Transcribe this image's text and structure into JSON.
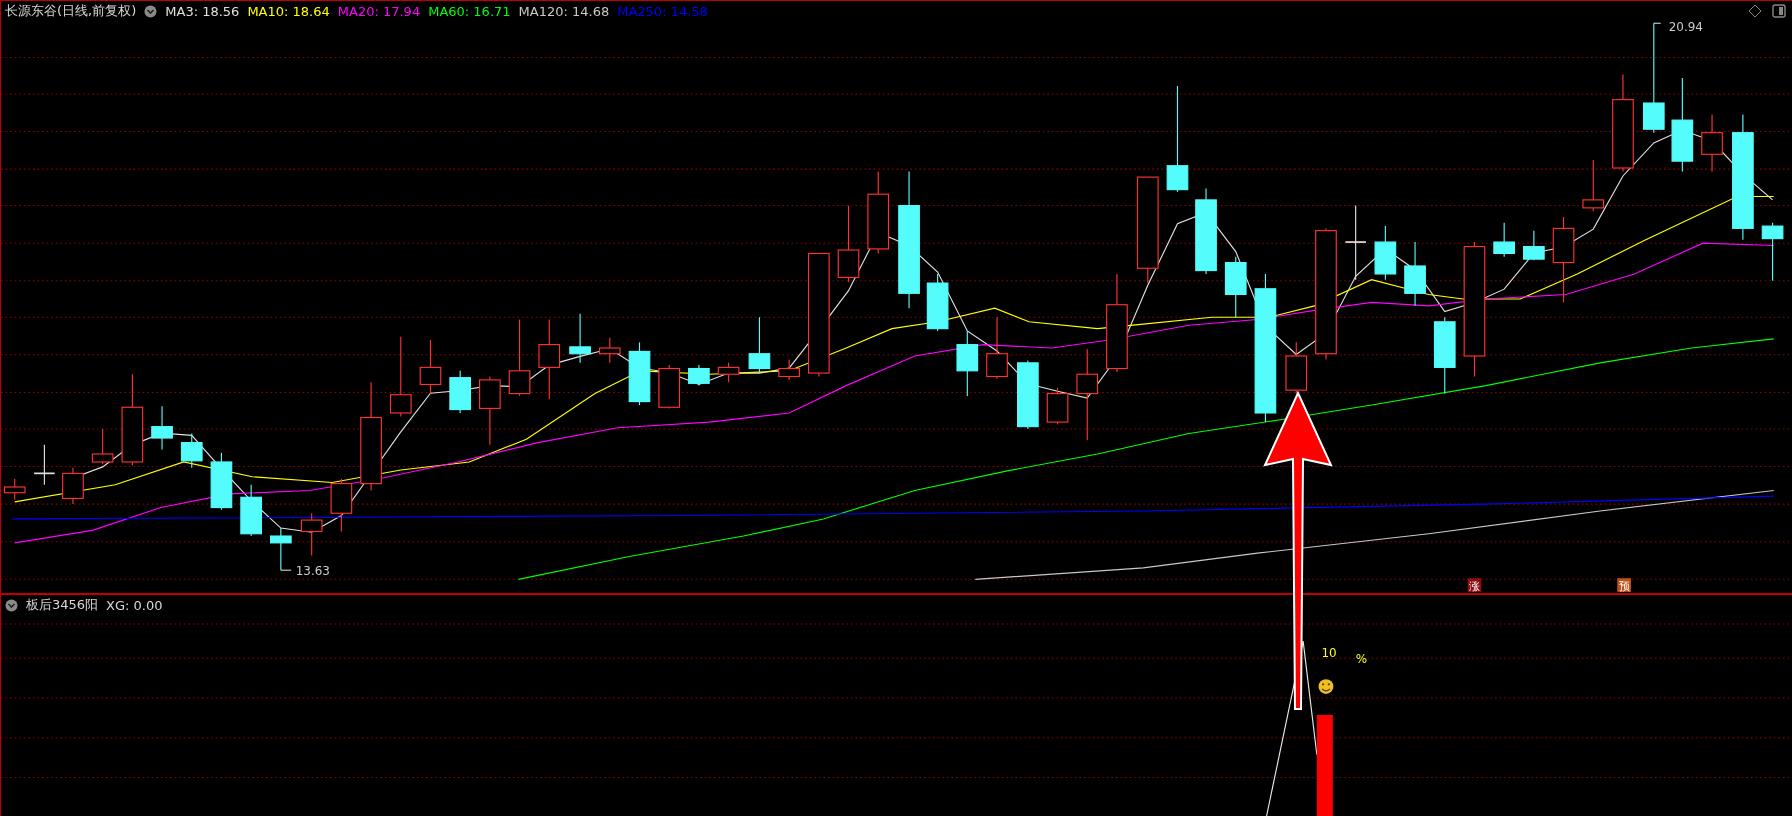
{
  "main_panel": {
    "title": "长源东谷(日线,前复权)",
    "indicators": [
      {
        "label": "MA3: 18.56",
        "color": "#e0e0e0"
      },
      {
        "label": "MA10: 18.64",
        "color": "#ffff00"
      },
      {
        "label": "MA20: 17.94",
        "color": "#ff00ff"
      },
      {
        "label": "MA60: 16.71",
        "color": "#00ff00"
      },
      {
        "label": "MA120: 14.68",
        "color": "#c8c8c8"
      },
      {
        "label": "MA250: 14.58",
        "color": "#0000ff"
      }
    ],
    "high_label": "20.94",
    "low_label": "13.63",
    "markers": [
      {
        "text": "涨",
        "color": "#8b0d0d"
      },
      {
        "text": "预",
        "color": "#c0501a"
      }
    ]
  },
  "sub_panel": {
    "title": "板后3456阳",
    "value": "XG: 0.00",
    "signal_number": "10",
    "signal_unit": "%"
  }
}
